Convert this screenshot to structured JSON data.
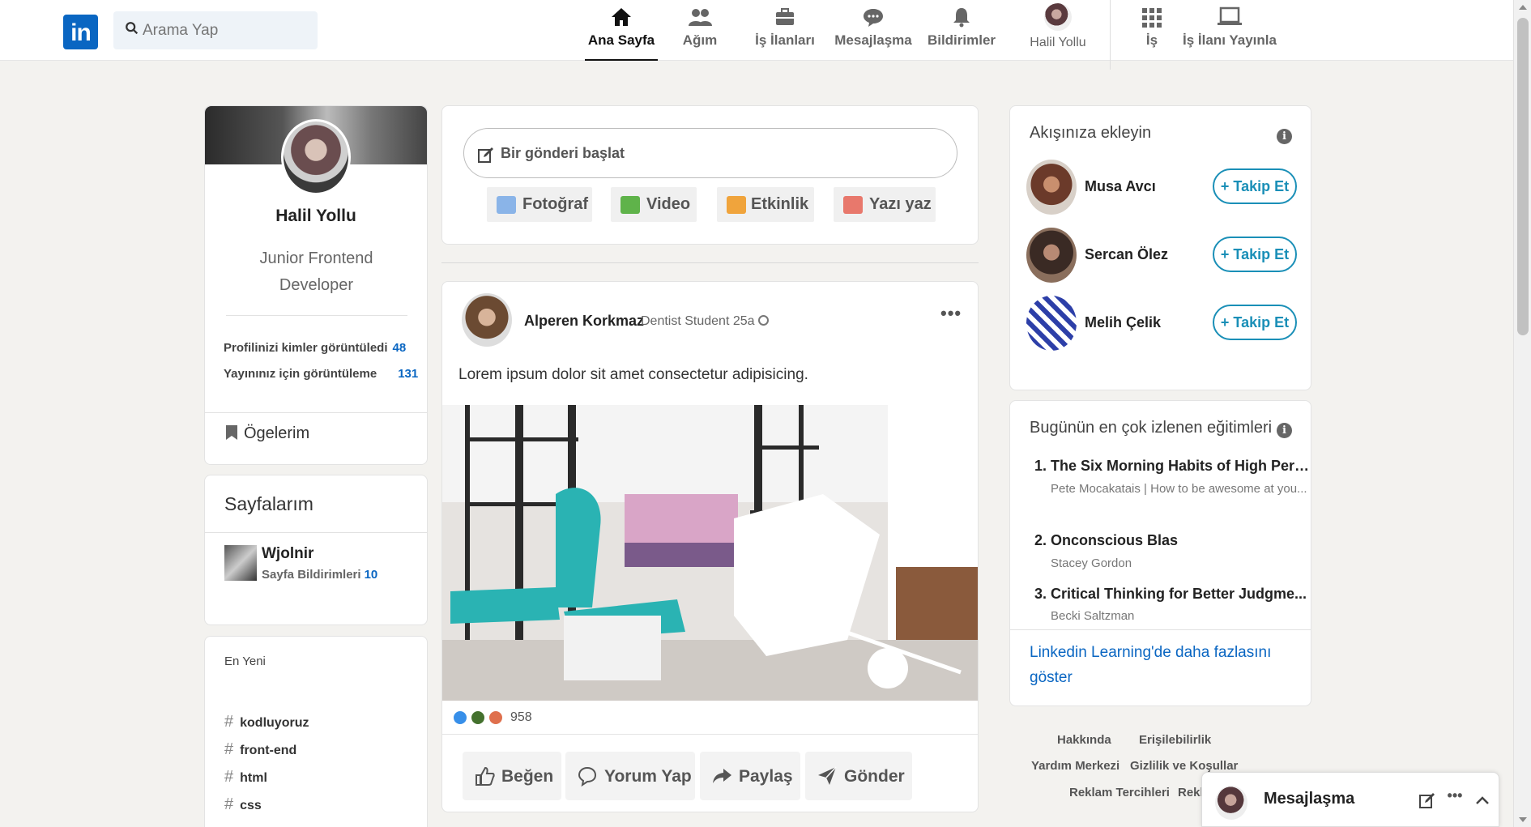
{
  "header": {
    "search_placeholder": "Arama Yap",
    "nav": [
      {
        "label": "Ana Sayfa",
        "icon": "home-icon"
      },
      {
        "label": "Ağım",
        "icon": "network-icon"
      },
      {
        "label": "İş İlanları",
        "icon": "briefcase-icon"
      },
      {
        "label": "Mesajlaşma",
        "icon": "chat-icon"
      },
      {
        "label": "Bildirimler",
        "icon": "bell-icon"
      },
      {
        "label": "Halil Yollu",
        "icon": "avatar"
      },
      {
        "label": "İş",
        "icon": "grid-icon"
      },
      {
        "label": "İş İlanı Yayınla",
        "icon": "laptop-icon"
      }
    ]
  },
  "profile": {
    "name": "Halil Yollu",
    "title": "Junior Frontend Developer",
    "stats": [
      {
        "label": "Profilinizi kimler görüntüledi",
        "value": "48"
      },
      {
        "label": "Yayınınız için görüntüleme",
        "value": "131"
      }
    ],
    "items_label": "Ögelerim"
  },
  "pages": {
    "title": "Sayfalarım",
    "page_name": "Wjolnir",
    "notif_label": "Sayfa Bildirimleri",
    "notif_count": "10"
  },
  "recent": {
    "title": "En Yeni",
    "hashtags": [
      "kodluyoruz",
      "front-end",
      "html",
      "css"
    ]
  },
  "composer": {
    "placeholder": "Bir gönderi başlat",
    "actions": [
      "Fotoğraf",
      "Video",
      "Etkinlik",
      "Yazı yaz"
    ]
  },
  "post": {
    "author": "Alperen Korkmaz",
    "meta": "Dentist Student 25a",
    "text": "Lorem ipsum dolor sit amet consectetur adipisicing.",
    "reaction_count": "958",
    "actions": [
      "Beğen",
      "Yorum Yap",
      "Paylaş",
      "Gönder"
    ]
  },
  "suggestions": {
    "title": "Akışınıza ekleyin",
    "follow_label": "+ Takip Et",
    "people": [
      "Musa Avcı",
      "Sercan Ölez",
      "Melih Çelik"
    ]
  },
  "learning": {
    "title": "Bugünün en çok izlenen eğitimleri",
    "courses": [
      {
        "title": "1. The Six Morning Habits of High Perf...",
        "sub": "Pete Mocakatais | How to be awesome at you..."
      },
      {
        "title": "2. Onconscious Blas",
        "sub": "Stacey Gordon"
      },
      {
        "title": "3. Critical Thinking for Better Judgme...",
        "sub": "Becki Saltzman"
      }
    ],
    "more_link": "Linkedin Learning'de daha fazlasını göster"
  },
  "footer": [
    "Hakkında",
    "Erişilebilirlik",
    "Yardım Merkezi",
    "Gizlilik ve Koşullar",
    "Reklam Tercihleri",
    "Rekl"
  ],
  "messaging": {
    "title": "Mesajlaşma"
  },
  "colors": {
    "brand": "#0a66c2",
    "follow": "#1a8fb7",
    "background": "#f3f2ef"
  }
}
